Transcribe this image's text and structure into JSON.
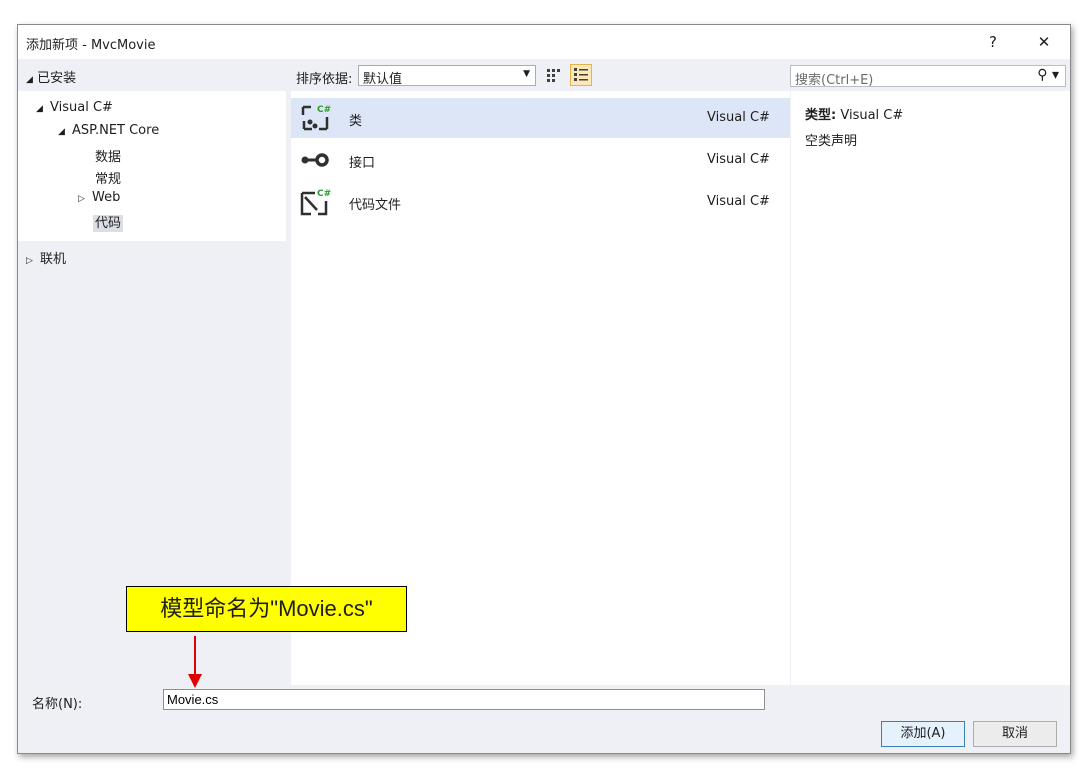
{
  "window": {
    "title": "添加新项 - MvcMovie",
    "help_label": "?",
    "close_label": "✕"
  },
  "left_panel": {
    "installed_label": "已安装",
    "tree": [
      {
        "label": "Visual C#"
      },
      {
        "label": "ASP.NET Core"
      },
      {
        "label": "数据"
      },
      {
        "label": "常规"
      },
      {
        "label": "Web"
      },
      {
        "label": "代码"
      }
    ],
    "online_label": "联机"
  },
  "toolbar": {
    "sort_label": "排序依据:",
    "sort_value": "默认值"
  },
  "search": {
    "placeholder": "搜索(Ctrl+E)"
  },
  "items": [
    {
      "name": "类",
      "language": "Visual C#",
      "icon": "class-icon"
    },
    {
      "name": "接口",
      "language": "Visual C#",
      "icon": "interface-icon"
    },
    {
      "name": "代码文件",
      "language": "Visual C#",
      "icon": "code-file-icon"
    }
  ],
  "details": {
    "type_label": "类型:",
    "type_value": "Visual C#",
    "description": "空类声明"
  },
  "name_field": {
    "label": "名称(N):",
    "value": "Movie.cs"
  },
  "buttons": {
    "add": "添加(A)",
    "cancel": "取消"
  },
  "annotation": {
    "text": "模型命名为\"Movie.cs\""
  },
  "colors": {
    "selection": "#dde6f7",
    "accent_green": "#2e9a2e",
    "callout_bg": "#ffff00",
    "arrow": "#e00000"
  }
}
